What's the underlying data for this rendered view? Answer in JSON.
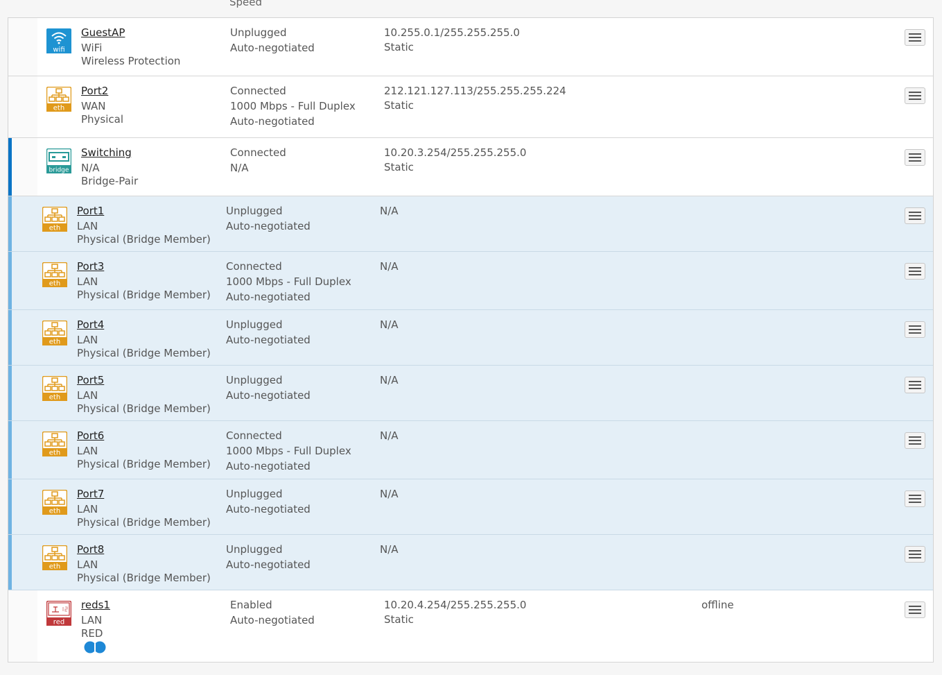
{
  "header": {
    "speed_label": "Speed"
  },
  "rows": [
    {
      "name": "GuestAP",
      "zone": "WiFi",
      "type": "Wireless Protection",
      "status": [
        "Unplugged",
        "Auto-negotiated"
      ],
      "ip": [
        "10.255.0.1/255.255.255.0",
        "Static"
      ],
      "icon": "wifi-icon",
      "icon_label": "wifi",
      "icon_color": "#1e93d2"
    },
    {
      "name": "Port2",
      "zone": "WAN",
      "type": "Physical",
      "status": [
        "Connected",
        "1000 Mbps - Full Duplex",
        "Auto-negotiated"
      ],
      "ip": [
        "212.121.127.113/255.255.255.224",
        "Static"
      ],
      "icon": "ethernet-icon",
      "icon_label": "eth",
      "icon_color": "#e09a1b"
    },
    {
      "name": "Switching",
      "zone": "N/A",
      "type": "Bridge-Pair",
      "status": [
        "Connected",
        "N/A"
      ],
      "ip": [
        "10.20.3.254/255.255.255.0",
        "Static"
      ],
      "icon": "bridge-icon",
      "icon_label": "bridge",
      "icon_color": "#2a9a98"
    },
    {
      "name": "Port1",
      "zone": "LAN",
      "type": "Physical (Bridge Member)",
      "status": [
        "Unplugged",
        "Auto-negotiated"
      ],
      "ip": [
        "N/A"
      ],
      "icon": "ethernet-icon",
      "icon_label": "eth",
      "icon_color": "#e09a1b"
    },
    {
      "name": "Port3",
      "zone": "LAN",
      "type": "Physical (Bridge Member)",
      "status": [
        "Connected",
        "1000 Mbps - Full Duplex",
        "Auto-negotiated"
      ],
      "ip": [
        "N/A"
      ],
      "icon": "ethernet-icon",
      "icon_label": "eth",
      "icon_color": "#e09a1b"
    },
    {
      "name": "Port4",
      "zone": "LAN",
      "type": "Physical (Bridge Member)",
      "status": [
        "Unplugged",
        "Auto-negotiated"
      ],
      "ip": [
        "N/A"
      ],
      "icon": "ethernet-icon",
      "icon_label": "eth",
      "icon_color": "#e09a1b"
    },
    {
      "name": "Port5",
      "zone": "LAN",
      "type": "Physical (Bridge Member)",
      "status": [
        "Unplugged",
        "Auto-negotiated"
      ],
      "ip": [
        "N/A"
      ],
      "icon": "ethernet-icon",
      "icon_label": "eth",
      "icon_color": "#e09a1b"
    },
    {
      "name": "Port6",
      "zone": "LAN",
      "type": "Physical (Bridge Member)",
      "status": [
        "Connected",
        "1000 Mbps - Full Duplex",
        "Auto-negotiated"
      ],
      "ip": [
        "N/A"
      ],
      "icon": "ethernet-icon",
      "icon_label": "eth",
      "icon_color": "#e09a1b"
    },
    {
      "name": "Port7",
      "zone": "LAN",
      "type": "Physical (Bridge Member)",
      "status": [
        "Unplugged",
        "Auto-negotiated"
      ],
      "ip": [
        "N/A"
      ],
      "icon": "ethernet-icon",
      "icon_label": "eth",
      "icon_color": "#e09a1b"
    },
    {
      "name": "Port8",
      "zone": "LAN",
      "type": "Physical (Bridge Member)",
      "status": [
        "Unplugged",
        "Auto-negotiated"
      ],
      "ip": [
        "N/A"
      ],
      "icon": "ethernet-icon",
      "icon_label": "eth",
      "icon_color": "#e09a1b"
    },
    {
      "name": "reds1",
      "zone": "LAN",
      "type": "RED",
      "status": [
        "Enabled",
        "Auto-negotiated"
      ],
      "ip": [
        "10.20.4.254/255.255.255.0",
        "Static"
      ],
      "extra": "offline",
      "icon": "red-icon",
      "icon_label": "red",
      "icon_color": "#c0393b",
      "toggle_icon": "connection-toggle-icon",
      "toggle_color": "#1e88d6"
    }
  ]
}
